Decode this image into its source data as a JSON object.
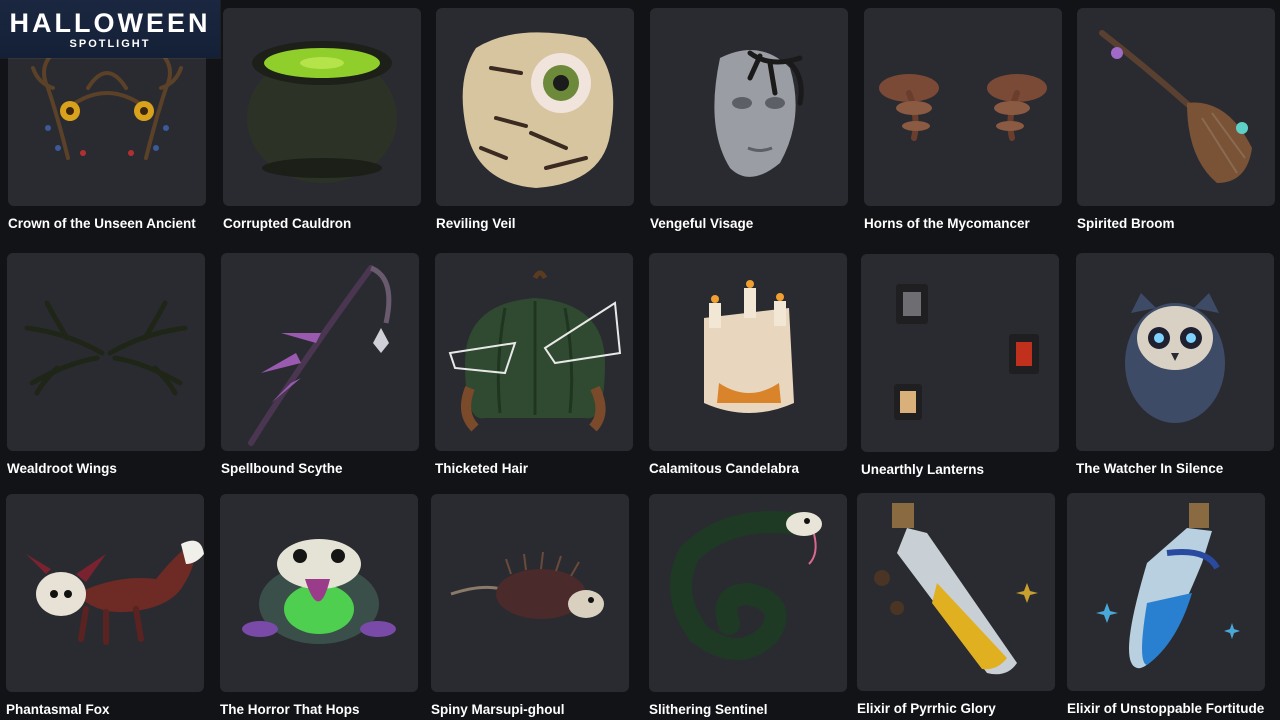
{
  "header": {
    "title": "HALLOWEEN",
    "subtitle": "SPOTLIGHT"
  },
  "items": [
    {
      "label": "Crown of the Unseen Ancient",
      "icon": "antler-crown-icon"
    },
    {
      "label": "Corrupted Cauldron",
      "icon": "cauldron-icon"
    },
    {
      "label": "Reviling Veil",
      "icon": "eyeball-mask-icon"
    },
    {
      "label": "Vengeful Visage",
      "icon": "cracked-face-mask-icon"
    },
    {
      "label": "Horns of the Mycomancer",
      "icon": "mushroom-horns-icon"
    },
    {
      "label": "Spirited Broom",
      "icon": "broom-icon"
    },
    {
      "label": "Wealdroot Wings",
      "icon": "root-wings-icon"
    },
    {
      "label": "Spellbound Scythe",
      "icon": "scythe-staff-icon"
    },
    {
      "label": "Thicketed Hair",
      "icon": "pumpkin-hair-icon"
    },
    {
      "label": "Calamitous Candelabra",
      "icon": "candle-hat-icon"
    },
    {
      "label": "Unearthly Lanterns",
      "icon": "lanterns-icon"
    },
    {
      "label": "The Watcher In Silence",
      "icon": "owl-icon"
    },
    {
      "label": "Phantasmal Fox",
      "icon": "fox-icon"
    },
    {
      "label": "The Horror That Hops",
      "icon": "frog-icon"
    },
    {
      "label": "Spiny Marsupi-ghoul",
      "icon": "spiny-marsupial-icon"
    },
    {
      "label": "Slithering Sentinel",
      "icon": "snake-icon"
    },
    {
      "label": "Elixir of Pyrrhic Glory",
      "icon": "yellow-potion-icon"
    },
    {
      "label": "Elixir of Unstoppable Fortitude",
      "icon": "blue-potion-icon"
    }
  ]
}
